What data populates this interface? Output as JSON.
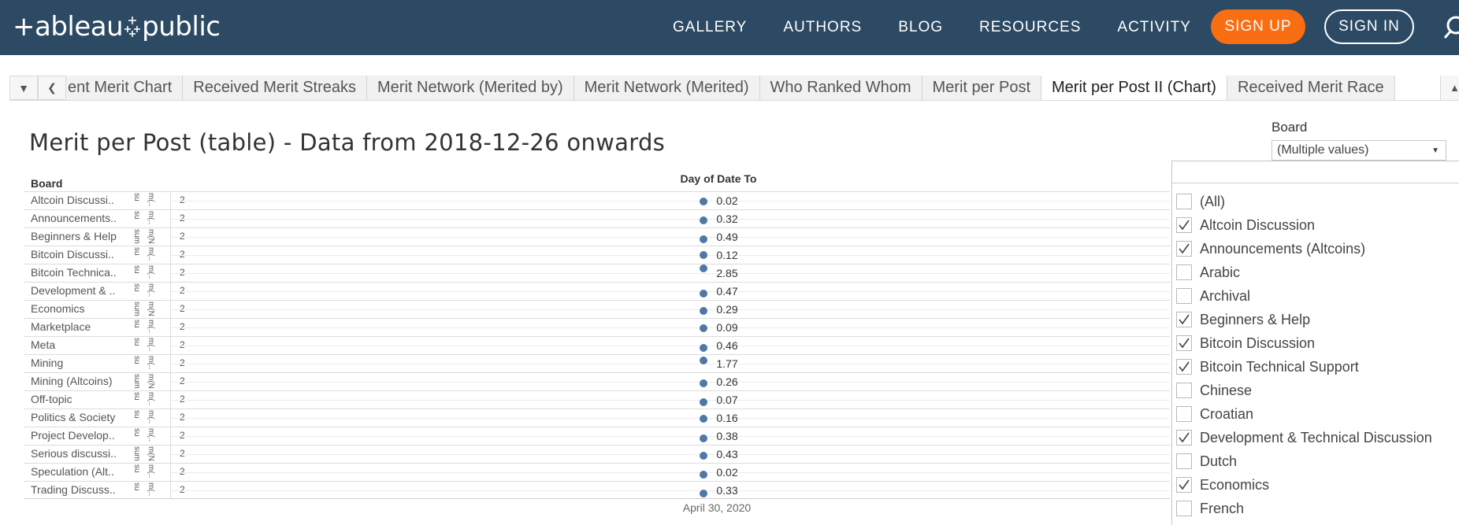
{
  "nav": {
    "logo": "+ableau",
    "logo_suffix": "public",
    "links": [
      "GALLERY",
      "AUTHORS",
      "BLOG",
      "RESOURCES",
      "ACTIVITY"
    ],
    "signup": "SIGN UP",
    "signin": "SIGN IN"
  },
  "tabs": [
    {
      "label": "ent Merit Chart",
      "active": false
    },
    {
      "label": "Received Merit Streaks",
      "active": false
    },
    {
      "label": "Merit Network (Merited by)",
      "active": false
    },
    {
      "label": "Merit Network (Merited)",
      "active": false
    },
    {
      "label": "Who Ranked Whom",
      "active": false
    },
    {
      "label": "Merit per Post",
      "active": false
    },
    {
      "label": "Merit per Post II (Chart)",
      "active": true
    },
    {
      "label": "Received Merit Race",
      "active": false
    }
  ],
  "sheet": {
    "title": "Merit per Post (table) - Data from 2018-12-26 onwards",
    "board_header": "Board",
    "date_header": "Day of Date To",
    "axis_date": "April 30, 2020"
  },
  "rows": [
    {
      "label": "Altcoin Discussi..",
      "m1": "su",
      "m2": "m(..",
      "m3": "2",
      "value": "0.02"
    },
    {
      "label": "Announcements..",
      "m1": "su",
      "m2": "m(..",
      "m3": "2",
      "value": "0.32"
    },
    {
      "label": "Beginners & Help",
      "m1": "sum",
      "m2": "m(N..",
      "m3": "2",
      "value": "0.49"
    },
    {
      "label": "Bitcoin Discussi..",
      "m1": "su",
      "m2": "m(..",
      "m3": "2",
      "value": "0.12"
    },
    {
      "label": "Bitcoin Technica..",
      "m1": "su",
      "m2": "m(..",
      "m3": "2",
      "value": "2.85"
    },
    {
      "label": "Development & ..",
      "m1": "su",
      "m2": "m(..",
      "m3": "2",
      "value": "0.47"
    },
    {
      "label": "Economics",
      "m1": "sum",
      "m2": "m(N..",
      "m3": "2",
      "value": "0.29"
    },
    {
      "label": "Marketplace",
      "m1": "su",
      "m2": "m(..",
      "m3": "2",
      "value": "0.09"
    },
    {
      "label": "Meta",
      "m1": "su",
      "m2": "m(..",
      "m3": "2",
      "value": "0.46"
    },
    {
      "label": "Mining",
      "m1": "su",
      "m2": "m(..",
      "m3": "2",
      "value": "1.77"
    },
    {
      "label": "Mining (Altcoins)",
      "m1": "sum",
      "m2": "m(N..",
      "m3": "2",
      "value": "0.26"
    },
    {
      "label": "Off-topic",
      "m1": "su",
      "m2": "m(..",
      "m3": "2",
      "value": "0.07"
    },
    {
      "label": "Politics & Society",
      "m1": "su",
      "m2": "m(..",
      "m3": "2",
      "value": "0.16"
    },
    {
      "label": "Project Develop..",
      "m1": "su",
      "m2": "m(..",
      "m3": "2",
      "value": "0.38"
    },
    {
      "label": "Serious discussi..",
      "m1": "sum",
      "m2": "m(N..",
      "m3": "2",
      "value": "0.43"
    },
    {
      "label": "Speculation (Alt..",
      "m1": "su",
      "m2": "m(..",
      "m3": "2",
      "value": "0.02"
    },
    {
      "label": "Trading Discuss..",
      "m1": "su",
      "m2": "m(..",
      "m3": "2",
      "value": "0.33"
    }
  ],
  "filter": {
    "title": "Board",
    "selected": "(Multiple values)",
    "items": [
      {
        "label": "(All)",
        "checked": false
      },
      {
        "label": "Altcoin Discussion",
        "checked": true
      },
      {
        "label": "Announcements (Altcoins)",
        "checked": true
      },
      {
        "label": "Arabic",
        "checked": false
      },
      {
        "label": "Archival",
        "checked": false
      },
      {
        "label": "Beginners & Help",
        "checked": true
      },
      {
        "label": "Bitcoin Discussion",
        "checked": true
      },
      {
        "label": "Bitcoin Technical Support",
        "checked": true
      },
      {
        "label": "Chinese",
        "checked": false
      },
      {
        "label": "Croatian",
        "checked": false
      },
      {
        "label": "Development & Technical Discussion",
        "checked": true
      },
      {
        "label": "Dutch",
        "checked": false
      },
      {
        "label": "Economics",
        "checked": true
      },
      {
        "label": "French",
        "checked": false
      }
    ]
  },
  "colors": {
    "nav_bg": "#2c4a63",
    "signup_bg": "#fa6e13",
    "mark": "#4e79a7"
  }
}
